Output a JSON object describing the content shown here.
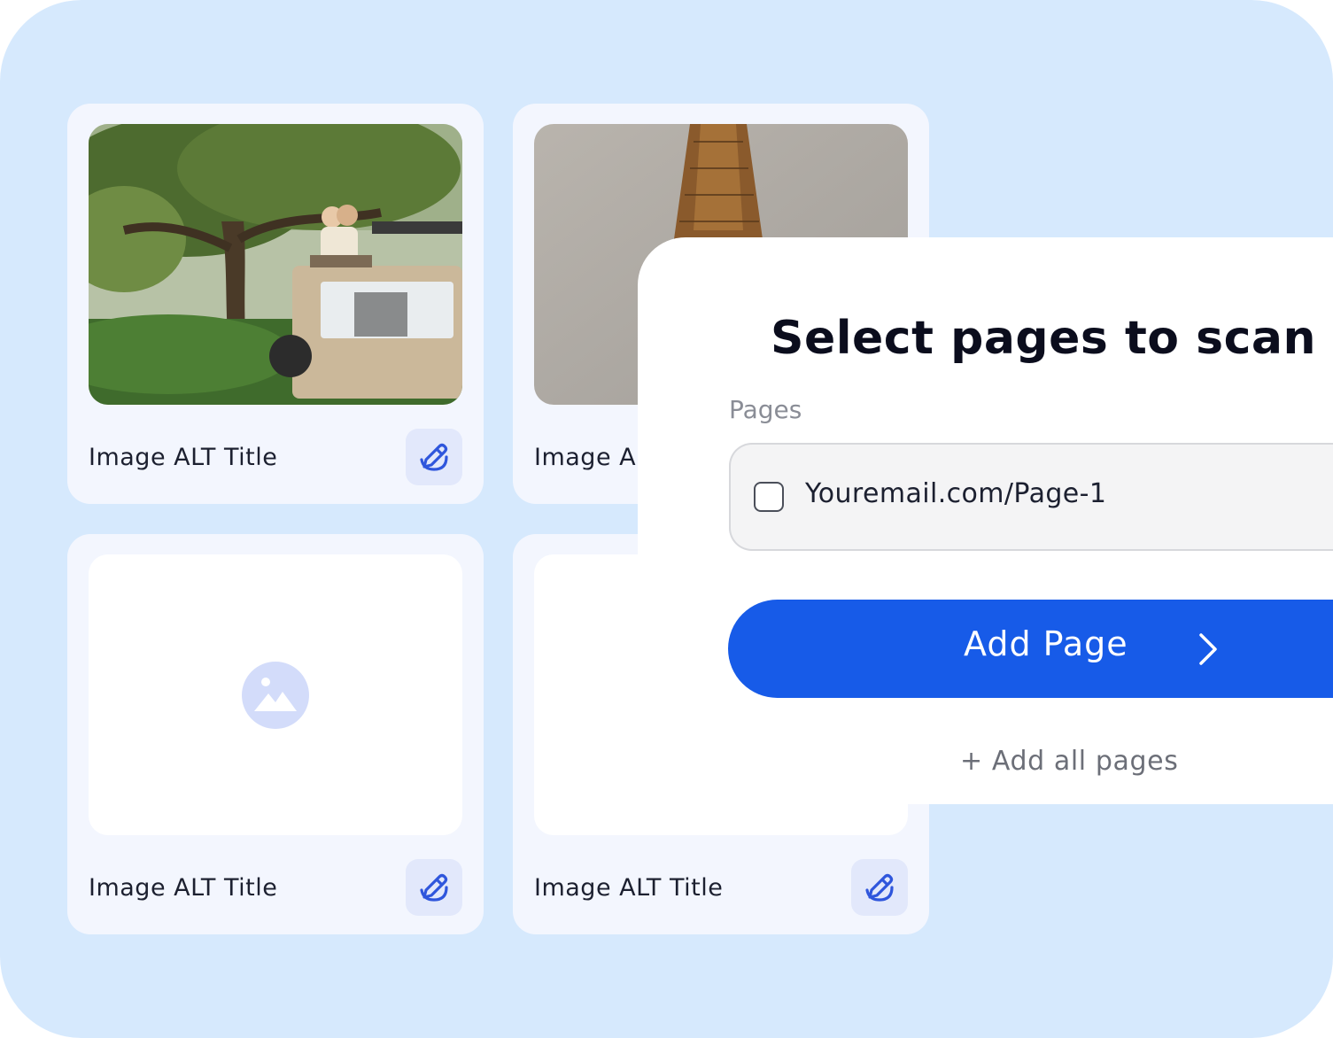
{
  "cards": [
    {
      "caption": "Image ALT Title"
    },
    {
      "caption": "Image ALT Title"
    },
    {
      "caption": "Image ALT Title"
    },
    {
      "caption": "Image ALT Title"
    }
  ],
  "modal": {
    "title": "Select pages to scan images",
    "field_label": "Pages",
    "page_option": "Youremail.com/Page-1",
    "primary_button": "Add Page",
    "secondary_link": "+ Add all pages"
  },
  "icons": {
    "edit": "pencil-edit-icon",
    "placeholder": "image-placeholder-icon",
    "arrow": "arrow-right-icon"
  },
  "colors": {
    "background": "#d6e9fd",
    "card": "#f3f6fe",
    "primary": "#175be8",
    "edit_button_bg": "#e2e8fb",
    "edit_icon": "#2f56dc"
  }
}
